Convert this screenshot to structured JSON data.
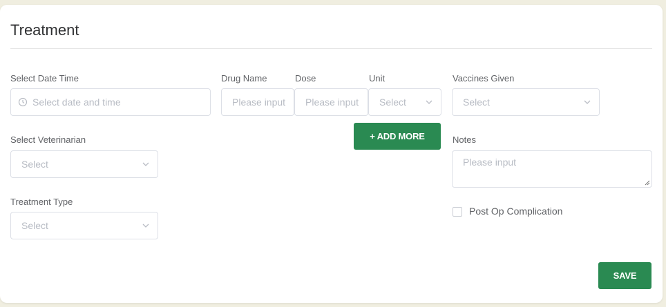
{
  "form": {
    "title": "Treatment",
    "date_time": {
      "label": "Select Date Time",
      "placeholder": "Select date and time"
    },
    "drug_name": {
      "label": "Drug Name",
      "placeholder": "Please input"
    },
    "dose": {
      "label": "Dose",
      "placeholder": "Please input"
    },
    "unit": {
      "label": "Unit",
      "placeholder": "Select"
    },
    "vaccines": {
      "label": "Vaccines Given",
      "placeholder": "Select"
    },
    "add_more_label": "+ ADD MORE",
    "veterinarian": {
      "label": "Select Veterinarian",
      "placeholder": "Select"
    },
    "notes": {
      "label": "Notes",
      "placeholder": "Please input"
    },
    "treatment_type": {
      "label": "Treatment Type",
      "placeholder": "Select"
    },
    "post_op": {
      "label": "Post Op Complication",
      "checked": false
    },
    "save_label": "SAVE"
  },
  "colors": {
    "accent": "#2a8a52",
    "background": "#f0eee0"
  },
  "icons": {
    "date": "clock-icon",
    "dropdown": "chevron-down-icon"
  }
}
